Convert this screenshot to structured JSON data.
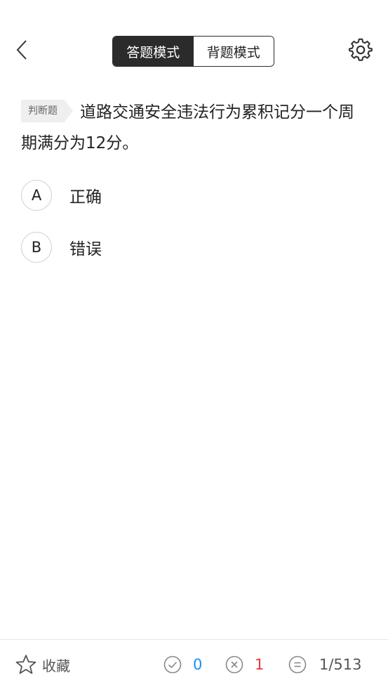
{
  "header": {
    "modes": [
      {
        "label": "答题模式",
        "active": true
      },
      {
        "label": "背题模式",
        "active": false
      }
    ]
  },
  "question": {
    "type_tag": "判断题",
    "text": "道路交通安全违法行为累积记分一个周期满分为12分。"
  },
  "options": [
    {
      "letter": "A",
      "text": "正确"
    },
    {
      "letter": "B",
      "text": "错误"
    }
  ],
  "footer": {
    "favorite_label": "收藏",
    "correct_count": "0",
    "wrong_count": "1",
    "progress": "1/513"
  },
  "colors": {
    "accent_dark": "#2b2b2b",
    "correct": "#1a8ff0",
    "wrong": "#e53935"
  },
  "icons": [
    "back-chevron-icon",
    "gear-icon",
    "star-icon",
    "check-circle-icon",
    "x-circle-icon",
    "equals-circle-icon"
  ]
}
